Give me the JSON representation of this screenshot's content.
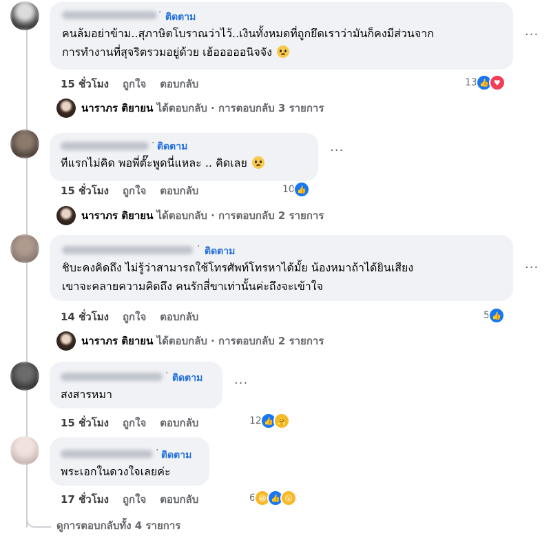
{
  "comments": [
    {
      "follow": "ติดตาม",
      "lines": [
        "คนล้มอย่าข้าม..สุภาษิตโบราณว่าไว้..เงินทั้งหมดที่ถูกยึดเราว่ามันก็คงมีส่วนจาก",
        "การทำงานที่สุจริตรวมอยู่ด้วย เฮ้อออออนิจจัง"
      ],
      "time": "15 ชั่วโมง",
      "like_label": "ถูกใจ",
      "reply_label": "ตอบกลับ",
      "reaction_count": "13",
      "reactions": [
        "like-icon",
        "love-icon"
      ],
      "reply_summary": {
        "name": "นาราภร ติยายน",
        "text": "ได้ตอบกลับ · การตอบกลับ 3 รายการ"
      }
    },
    {
      "follow": "ติดตาม",
      "lines": [
        "ทีแรกไม่คิด พอพี่ตั๊ะพูดนี่แหละ .. คิดเลย"
      ],
      "time": "15 ชั่วโมง",
      "like_label": "ถูกใจ",
      "reply_label": "ตอบกลับ",
      "reaction_count": "10",
      "reactions": [
        "like-icon"
      ],
      "reply_summary": {
        "name": "นาราภร ติยายน",
        "text": "ได้ตอบกลับ · การตอบกลับ 2 รายการ"
      }
    },
    {
      "follow": "ติดตาม",
      "lines": [
        "ชิบะคงคิดถึง ไม่รู้ว่าสามารถใช้โทรศัพท์โทรหาได้มั้ย น้องหมาถ้าได้ยินเสียง",
        "เขาจะคลายความคิดถึง คนรักสี่ขาเท่านั้นค่ะถึงจะเข้าใจ"
      ],
      "time": "14 ชั่วโมง",
      "like_label": "ถูกใจ",
      "reply_label": "ตอบกลับ",
      "reaction_count": "5",
      "reactions": [
        "like-icon"
      ],
      "reply_summary": {
        "name": "นาราภร ติยายน",
        "text": "ได้ตอบกลับ · การตอบกลับ 2 รายการ"
      }
    },
    {
      "follow": "ติดตาม",
      "lines": [
        "สงสารหมา"
      ],
      "time": "15 ชั่วโมง",
      "like_label": "ถูกใจ",
      "reply_label": "ตอบกลับ",
      "reaction_count": "12",
      "reactions": [
        "like-icon",
        "care-icon"
      ]
    },
    {
      "follow": "ติดตาม",
      "lines": [
        "พระเอกในดวงใจเลยค่ะ"
      ],
      "time": "17 ชั่วโมง",
      "like_label": "ถูกใจ",
      "reply_label": "ตอบกลับ",
      "reaction_count": "6",
      "reactions": [
        "haha-icon",
        "like-icon",
        "wow-icon"
      ]
    }
  ],
  "view_all_replies": "ดูการตอบกลับทั้ง 4 รายการ",
  "colors": {
    "follow": "#216fdb",
    "bubble": "#f0f2f5",
    "meta": "#65676b",
    "like": "#1877f2",
    "love": "#f33e58"
  }
}
